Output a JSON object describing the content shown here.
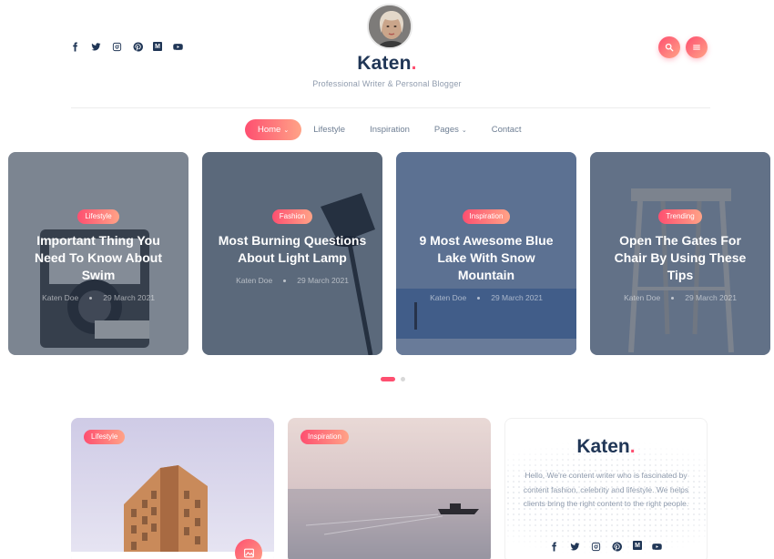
{
  "header": {
    "brand": "Katen",
    "brand_dot": ".",
    "tagline": "Professional Writer & Personal Blogger",
    "social_icons": [
      "facebook-icon",
      "twitter-icon",
      "instagram-icon",
      "pinterest-icon",
      "medium-icon",
      "youtube-icon"
    ],
    "medium_glyph": "M",
    "search_icon": "search-icon",
    "menu_icon": "hamburger-icon"
  },
  "nav": {
    "items": [
      {
        "label": "Home",
        "caret": "⌄",
        "active": true
      },
      {
        "label": "Lifestyle",
        "caret": "",
        "active": false
      },
      {
        "label": "Inspiration",
        "caret": "",
        "active": false
      },
      {
        "label": "Pages",
        "caret": "⌄",
        "active": false
      },
      {
        "label": "Contact",
        "caret": "",
        "active": false
      }
    ]
  },
  "slider": {
    "cards": [
      {
        "category": "Lifestyle",
        "title": "Important Thing You Need To Know About Swim",
        "author": "Katen Doe",
        "date": "29 March 2021"
      },
      {
        "category": "Fashion",
        "title": "Most Burning Questions About Light Lamp",
        "author": "Katen Doe",
        "date": "29 March 2021"
      },
      {
        "category": "Inspiration",
        "title": "9 Most Awesome Blue Lake With Snow Mountain",
        "author": "Katen Doe",
        "date": "29 March 2021"
      },
      {
        "category": "Trending",
        "title": "Open The Gates For Chair By Using These Tips",
        "author": "Katen Doe",
        "date": "29 March 2021"
      }
    ],
    "active_page": 1,
    "page_count": 2
  },
  "posts": [
    {
      "category": "Lifestyle"
    },
    {
      "category": "Inspiration"
    }
  ],
  "about_widget": {
    "brand": "Katen",
    "brand_dot": ".",
    "text": "Hello, We're content writer who is fascinated by content fashion, celebrity and lifestyle. We helps clients bring the right content to the right people."
  },
  "colors": {
    "accent": "#fe4f70",
    "accent_light": "#ffa387",
    "heading": "#203656",
    "muted": "#8f9bad"
  }
}
